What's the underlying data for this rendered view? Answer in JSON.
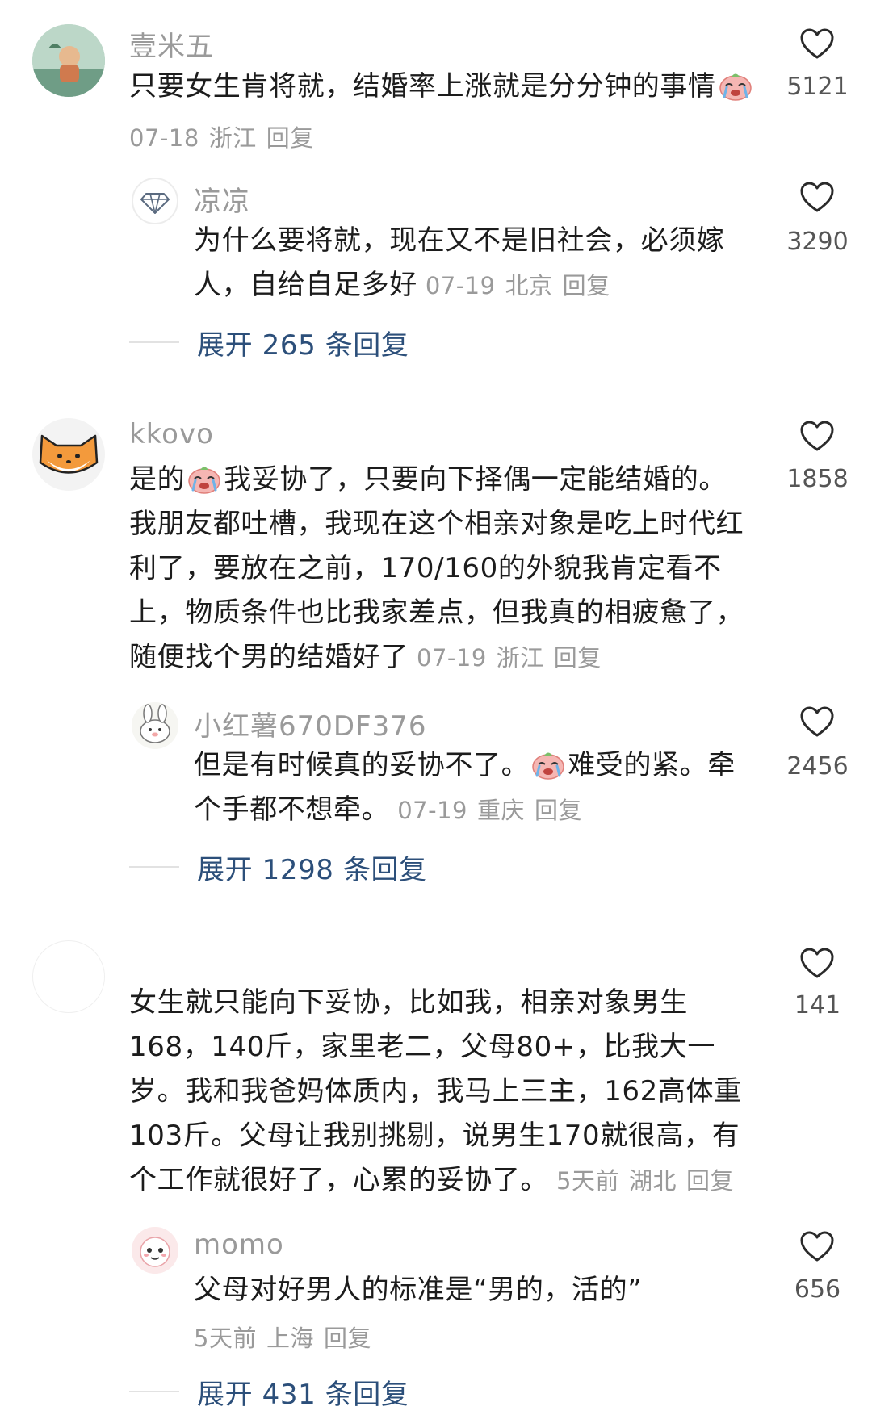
{
  "comments": [
    {
      "username": "壹米五",
      "text": "只要女生肯将就，结婚率上涨就是分分钟的事情",
      "date": "07-18",
      "location": "浙江",
      "reply_label": "回复",
      "likes": "5121",
      "replies": [
        {
          "username": "凉凉",
          "text_line1": "为什么要将就，现在又不是旧社会，必须嫁",
          "text_line2": "人，自给自足多好",
          "date": "07-19",
          "location": "北京",
          "reply_label": "回复",
          "likes": "3290"
        }
      ],
      "expand_label": "展开 265 条回复"
    },
    {
      "username": "kkovo",
      "text_line1_a": "是的",
      "text_line1_b": "我妥协了，只要向下择偶一定能结婚的。",
      "text_line2": "我朋友都吐槽，我现在这个相亲对象是吃上时代红",
      "text_line3": "利了，要放在之前，170/160的外貌我肯定看不",
      "text_line4": "上，物质条件也比我家差点，但我真的相疲惫了，",
      "text_line5": "随便找个男的结婚好了",
      "date": "07-19",
      "location": "浙江",
      "reply_label": "回复",
      "likes": "1858",
      "replies": [
        {
          "username": "小红薯670DF376",
          "text_line1_a": "但是有时候真的妥协不了。",
          "text_line1_b": "难受的紧。牵",
          "text_line2": "个手都不想牵。",
          "date": "07-19",
          "location": "重庆",
          "reply_label": "回复",
          "likes": "2456"
        }
      ],
      "expand_label": "展开 1298 条回复"
    },
    {
      "username": "",
      "text_line1": "女生就只能向下妥协，比如我，相亲对象男生",
      "text_line2": "168，140斤，家里老二，父母80+，比我大一",
      "text_line3": "岁。我和我爸妈体质内，我马上三主，162高体重",
      "text_line4": "103斤。父母让我别挑剔，说男生170就很高，有",
      "text_line5": "个工作就很好了，心累的妥协了。",
      "date": "5天前",
      "location": "湖北",
      "reply_label": "回复",
      "likes": "141",
      "replies": [
        {
          "username": "momo",
          "text": "父母对好男人的标准是“男的，活的”",
          "date": "5天前",
          "location": "上海",
          "reply_label": "回复",
          "likes": "656"
        }
      ],
      "expand_label": "展开 431 条回复"
    }
  ],
  "icons": {
    "like": "heart-outline-icon",
    "emoji": "crying-face-emoji",
    "verified": "diamond-icon"
  },
  "colors": {
    "username": "#9a9a9a",
    "meta": "#9a9a9a",
    "expand_link": "#2c4f7a",
    "text": "#1c1c1c"
  }
}
